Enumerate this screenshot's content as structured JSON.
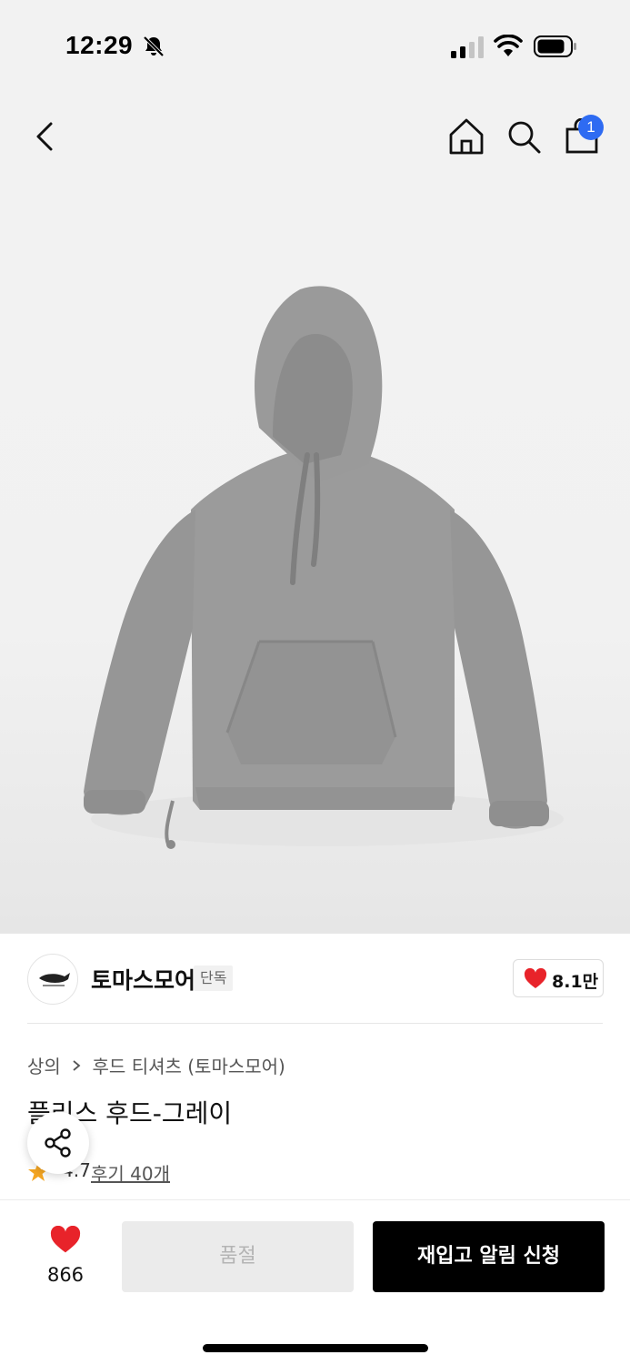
{
  "status_bar": {
    "time": "12:29",
    "icons": [
      "bell-slash-icon",
      "signal-icon",
      "wifi-icon",
      "battery-icon"
    ]
  },
  "header": {
    "icons": [
      "back-icon",
      "home-icon",
      "search-icon",
      "bag-icon"
    ],
    "cart_badge": "1",
    "badge_color": "#2e6bf2"
  },
  "product": {
    "image_subject": "gray fleece hoodie",
    "image_color": "#9b9b9b"
  },
  "brand": {
    "name": "토마스모어",
    "tag": "단독",
    "like_count": "8.1만",
    "like_color": "#e8232a"
  },
  "breadcrumb": {
    "category": "상의",
    "subcategory": "후드 티셔츠 (토마스모어)"
  },
  "product_info": {
    "title": "플리스 후드-그레이",
    "rating": "4.7",
    "reviews": "후기 40개"
  },
  "bottom_bar": {
    "wish_count": "866",
    "soldout_label": "품절",
    "restock_label": "재입고 알림 신청"
  }
}
